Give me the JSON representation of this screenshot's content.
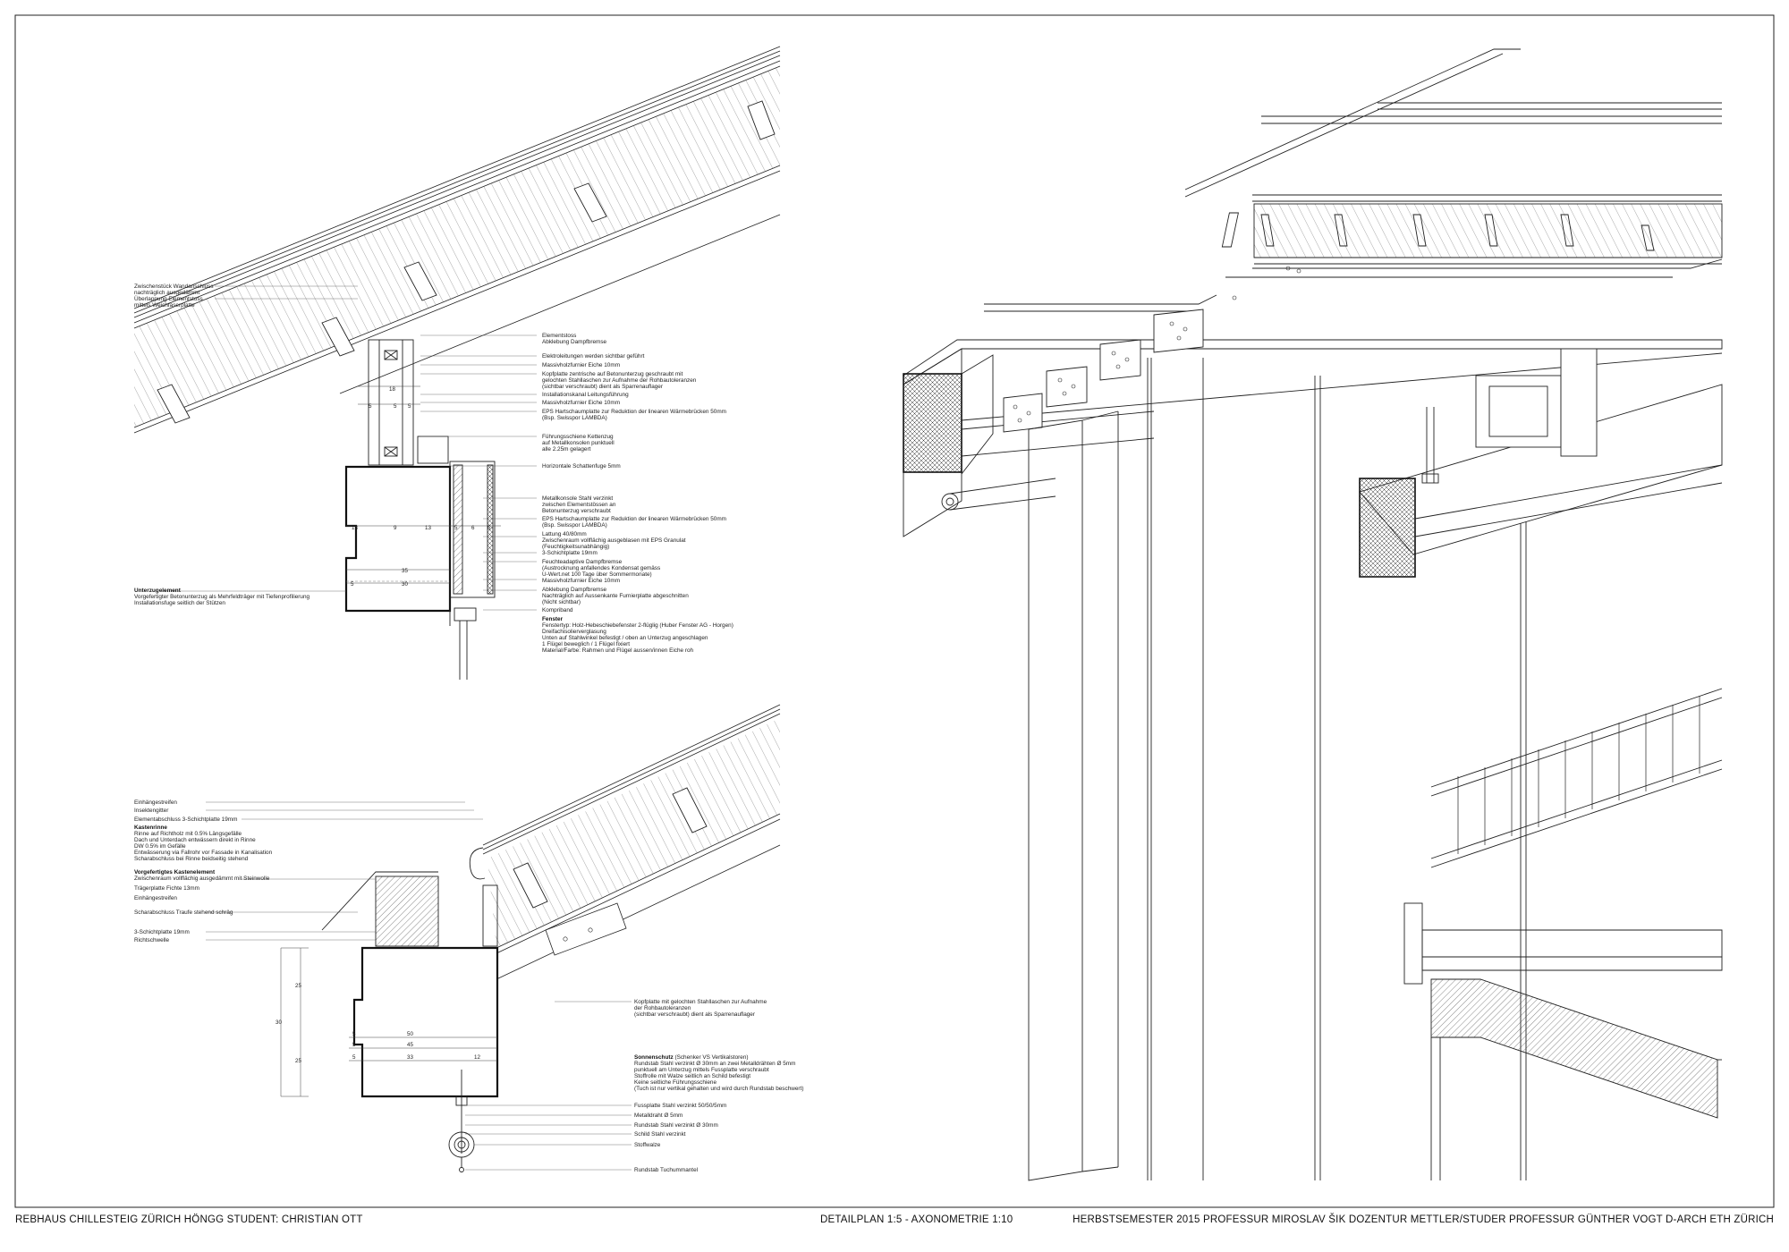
{
  "footer": {
    "project": "REBHAUS CHILLESTEIG ZÜRICH HÖNGG   STUDENT: CHRISTIAN OTT",
    "title": "DETAILPLAN 1:5  - AXONOMETRIE 1:10",
    "course": "HERBSTSEMESTER 2015   PROFESSUR MIROSLAV ŠIK   DOZENTUR METTLER/STUDER   PROFESSUR GÜNTHER VOGT   D-ARCH   ETH ZÜRICH"
  },
  "detail_top": {
    "labels_left": [
      "Zwischenstück Wandanschluss",
      "nachträglich ausgedämmt",
      "Überlappung Elementstoss",
      "mittels Weichfaserplatte"
    ],
    "label_left_bottom_title": "Unterzugelement",
    "label_left_bottom": [
      "Vorgefertigter Betonunterzug als Mehrfeldträger mit Tiefenprofilierung",
      "Installationsfuge seitlich der Stützen"
    ],
    "labels_right": [
      "Elementstoss",
      "Abklebung Dampfbremse",
      "Elektroleitungen werden sichtbar geführt",
      "Massivholzfurnier Eiche 10mm",
      "Kopfplatte zentrische auf Betonunterzug geschraubt mit",
      "gelochten Stahllaschen zur Aufnahme der Rohbautoleranzen",
      "(sichtbar verschraubt) dient als Sparrenauflager",
      "Installationskanal Leitungsführung",
      "Massivholzfurnier Eiche 10mm",
      "EPS Hartschaumplatte zur Reduktion der linearen Wärmebrücken 50mm",
      "(Bsp. Swisspor LAMBDA)",
      "Führungsschiene Kettenzug",
      "auf Metallkonsolen punktuell",
      "alle 2.25m gelagert",
      "Horizontale Schattenfuge 5mm",
      "Metallkonsole Stahl verzinkt",
      "zwischen Elementstössen an",
      "Betonunterzug verschraubt",
      "EPS Hartschaumplatte zur Reduktion der linearen Wärmebrücken 50mm",
      "(Bsp. Swisspor LAMBDA)",
      "Lattung 40/80mm",
      "Zwischenraum vollflächig ausgeblasen mit EPS Granulat",
      "(Feuchtigkeitsunabhängig)",
      "3-Schichtplatte 19mm",
      "Feuchteadaptive Dampfbremse",
      "(Austrocknung anfallendes Kondensat gemäss",
      "U-Wert.net 100 Tage über Sommermonate)",
      "Massivholzfurnier Eiche 10mm",
      "Abklebung Dampfbremse",
      "Nachträglich auf Aussenkante Furnierplatte abgeschnitten",
      "(Nicht sichtbar)",
      "Kompriband"
    ],
    "window_title": "Fenster",
    "window_lines": [
      "Fenstertyp: Holz-Hebeschiebefenster 2-flüglig (Huber Fenster AG - Horgen)",
      "Dreifachisolierverglasung",
      "Unten auf Stahlwinkel befestigt / oben an Unterzug angeschlagen",
      "1 Flügel beweglich / 1 Flügel fixiert",
      "Material/Farbe: Rahmen und Flügel aussen/innen Eiche roh"
    ],
    "dims": [
      "18",
      "5",
      "5",
      "5",
      "13",
      "9",
      "13",
      "5",
      "6",
      "5",
      "35",
      "5",
      "30"
    ]
  },
  "detail_bottom": {
    "labels_left": [
      "Einhängestreifen",
      "Insektengitter",
      "Elementabschluss 3-Schichtplatte 19mm"
    ],
    "label_kasten_title": "Kastenrinne",
    "label_kasten": [
      "Rinne auf Richtholz mit 0.5% Längsgefälle",
      "Dach und Unterdach entwässern direkt in Rinne",
      "DW 0.5% im Gefälle",
      "Entwässerung via Fallrohr vor Fassade in Kanalisation",
      "Scharabschluss bei Rinne beidseitig stehend"
    ],
    "label_vorgef_title": "Vorgefertigtes Kastenelement",
    "label_vorgef": [
      "Zwischenraum vollflächig ausgedämmt mit Steinwolle",
      "Trägerplatte Fichte 13mm",
      "Einhängestreifen",
      "Scharabschluss Traufe stehend schräg",
      "3-Schichtplatte 19mm",
      "Richtschwelle"
    ],
    "labels_right": [
      "Kopfplatte mit gelochten Stahllaschen zur Aufnahme",
      "der Rohbautoleranzen",
      "(sichtbar verschraubt) dient als Sparrenauflager"
    ],
    "sun_title": "Sonnenschutz",
    "sun_title_suffix": " (Schenker VS Vertikalstoren)",
    "sun_lines": [
      "Rundstab Stahl verzinkt Ø 30mm an zwei Metalldrähten Ø 5mm",
      "punktuell am Unterzug mittels Fussplatte verschraubt",
      "Stoffrolle mit Walze seitlich an Schild befestigt",
      "Keine seitliche Führungsschiene",
      "(Tuch ist nur vertikal gehalten und wird durch Rundstab beschwert)"
    ],
    "labels_bottom": [
      "Fussplatte Stahl verzinkt 50/50/5mm",
      "Metalldraht Ø 5mm",
      "Rundstab Stahl verzinkt Ø 30mm",
      "Schild Stahl verzinkt",
      "Stoffwalze",
      "Rundstab Tuchummantel"
    ],
    "dims": [
      "25",
      "30",
      "25",
      "5",
      "5",
      "5",
      "50",
      "45",
      "33",
      "12"
    ]
  }
}
